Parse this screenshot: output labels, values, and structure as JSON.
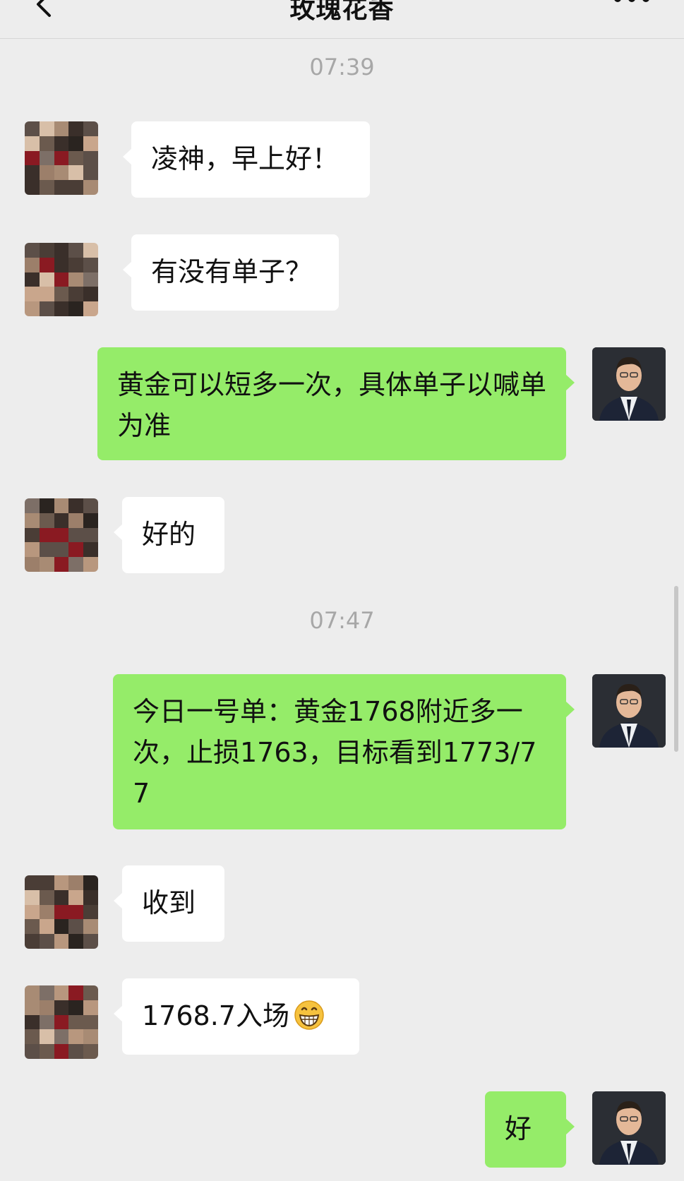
{
  "header": {
    "title": "玫瑰花香",
    "back_icon": "chevron-left-icon",
    "more_icon": "more-dots-icon"
  },
  "messages": [
    {
      "type": "time",
      "text": "07:39"
    },
    {
      "type": "in",
      "text": "凌神，早上好！"
    },
    {
      "type": "in",
      "text": "有没有单子？"
    },
    {
      "type": "out",
      "text": "黄金可以短多一次，具体单子以喊单为准"
    },
    {
      "type": "in",
      "text": "好的"
    },
    {
      "type": "time",
      "text": "07:47"
    },
    {
      "type": "out",
      "text": "今日一号单：黄金1768附近多一次，止损1763，目标看到1773/77"
    },
    {
      "type": "in",
      "text": "收到"
    },
    {
      "type": "in",
      "text": "1768.7入场",
      "emoji": "grinning-face-icon"
    },
    {
      "type": "out",
      "text": "好"
    }
  ],
  "colors": {
    "background": "#ededed",
    "incoming_bubble": "#ffffff",
    "outgoing_bubble": "#95ec69",
    "timestamp": "#a7a7a7"
  }
}
